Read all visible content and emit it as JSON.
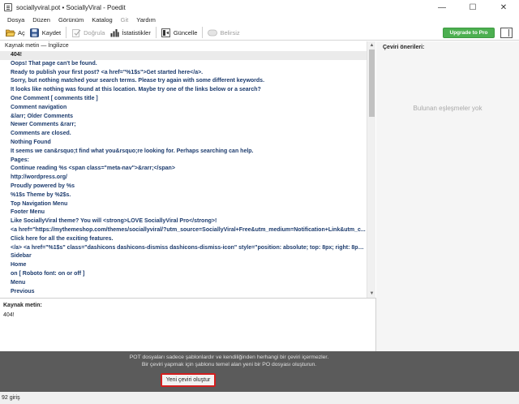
{
  "window": {
    "title": "sociallyviral.pot • SociallyViral - Poedit",
    "minimize": "—",
    "maximize": "☐",
    "close": "✕"
  },
  "menu": {
    "items": [
      {
        "label": "Dosya",
        "enabled": true
      },
      {
        "label": "Düzen",
        "enabled": true
      },
      {
        "label": "Görünüm",
        "enabled": true
      },
      {
        "label": "Katalog",
        "enabled": true
      },
      {
        "label": "Git",
        "enabled": false
      },
      {
        "label": "Yardım",
        "enabled": true
      }
    ]
  },
  "toolbar": {
    "open_label": "Aç",
    "save_label": "Kaydet",
    "validate_label": "Doğrula",
    "stats_label": "İstatistikler",
    "update_label": "Güncelle",
    "fuzzy_label": "Belirsiz",
    "upgrade_label": "Upgrade to Pro"
  },
  "list": {
    "header": "Kaynak metin — İngilizce",
    "rows": [
      "404!",
      "Oops! That page can't be found.",
      "Ready to publish your first post? <a href=\"%1$s\">Get started here</a>.",
      "Sorry, but nothing matched your search terms. Please try again with some different keywords.",
      "It looks like nothing was found at this location. Maybe try one of the links below or a search?",
      "One Comment  [ comments title ]",
      "Comment navigation",
      "&larr; Older Comments",
      "Newer Comments &rarr;",
      "Comments are closed.",
      "Nothing Found",
      "It seems we can&rsquo;t find what you&rsquo;re looking for. Perhaps searching can help.",
      "Pages:",
      "Continue reading %s <span class=\"meta-nav\">&rarr;</span>",
      "http://wordpress.org/",
      "Proudly powered by %s",
      "%1$s Theme by %2$s.",
      "Top Navigation Menu",
      "Footer Menu",
      "Like SociallyViral theme? You will <strong>LOVE SociallyViral Pro</strong>!",
      "<a href=\"https://mythemeshop.com/themes/sociallyviral/?utm_source=SociallyViral+Free&utm_medium=Notification+Link&utm_c...",
      "Click here for all the exciting features.",
      "</a> <a href=\"%1$s\" class=\"dashicons dashicons-dismiss dashicons-dismiss-icon\" style=\"position: absolute; top: 8px; right: 8px; color:...",
      "Sidebar",
      "Home",
      "on  [ Roboto font: on or off ]",
      "Menu",
      "Previous"
    ],
    "selected_index": 0
  },
  "sidebar": {
    "title": "Çeviri önerileri:",
    "empty_text": "Bulunan eşleşmeler yok"
  },
  "source": {
    "label": "Kaynak metin:",
    "text": "404!"
  },
  "notice": {
    "line1": "POT dosyaları sadece şablonlardır ve kendiliğinden herhangi bir çeviri içermezler.",
    "line2": "Bir çeviri yapmak için şablonu temel alan yeni bir PO dosyası oluşturun.",
    "button_label": "Yeni çeviri oluştur"
  },
  "status": {
    "text": "92 giriş"
  },
  "colors": {
    "row_text": "#1d3c6e",
    "upgrade_button": "#4caf50",
    "highlight_border": "#d41e1e",
    "notice_bg": "#5b5b5b"
  }
}
